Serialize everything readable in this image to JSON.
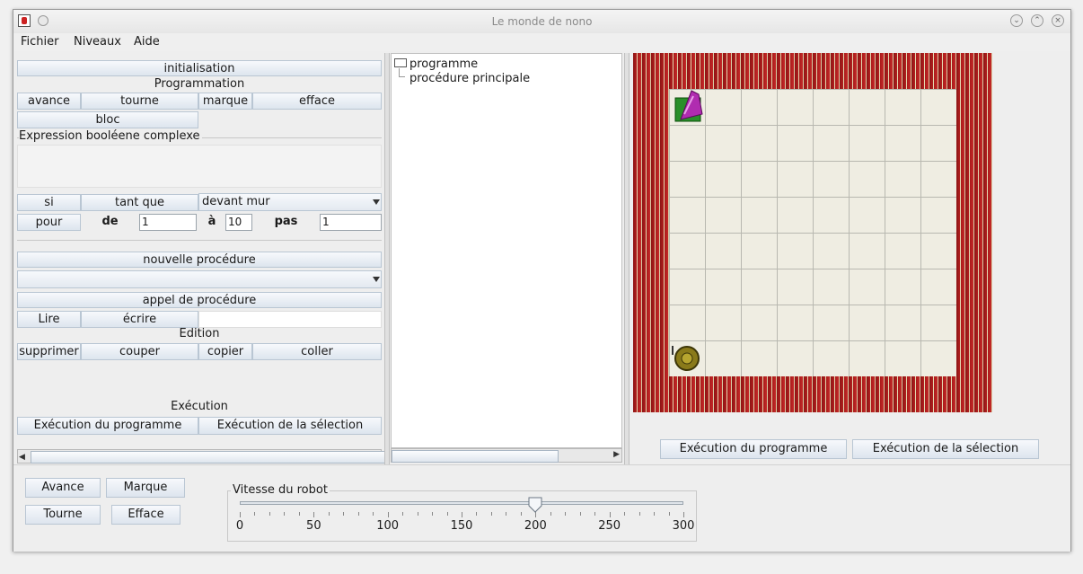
{
  "window": {
    "title": "Le monde de nono"
  },
  "menu": [
    "Fichier",
    "Niveaux",
    "Aide"
  ],
  "left_panel": {
    "initialisation": "initialisation",
    "programmation_heading": "Programmation",
    "avance": "avance",
    "tourne": "tourne",
    "marque": "marque",
    "efface": "efface",
    "bloc": "bloc",
    "bool_expr_label": "Expression booléene complexe",
    "si": "si",
    "tant_que": "tant que",
    "condition_selected": "devant mur",
    "pour": "pour",
    "de": "de",
    "de_value": "1",
    "a": "à",
    "a_value": "10",
    "pas": "pas",
    "pas_value": "1",
    "nouvelle_procedure": "nouvelle procédure",
    "appel_procedure": "appel de procédure",
    "lire": "Lire",
    "ecrire": "écrire",
    "edition_heading": "Edition",
    "supprimer": "supprimer",
    "couper": "couper",
    "copier": "copier",
    "coller": "coller",
    "execution_heading": "Exécution",
    "exec_programme": "Exécution du programme",
    "exec_selection": "Exécution de la sélection"
  },
  "tree": {
    "root": "programme",
    "child": "procédure principale"
  },
  "world_panel": {
    "exec_programme": "Exécution du programme",
    "exec_selection": "Exécution de la sélection"
  },
  "controls": {
    "avance": "Avance",
    "marque": "Marque",
    "tourne": "Tourne",
    "efface": "Efface"
  },
  "speed": {
    "label": "Vitesse du robot",
    "min": 0,
    "max": 300,
    "value": 200,
    "ticks": [
      "0",
      "50",
      "100",
      "150",
      "200",
      "250",
      "300"
    ]
  },
  "colors": {
    "button_bg": "#e4ebf2",
    "button_border": "#b9c6d3",
    "wall": "#a81a1a",
    "grid": "#efede2"
  }
}
